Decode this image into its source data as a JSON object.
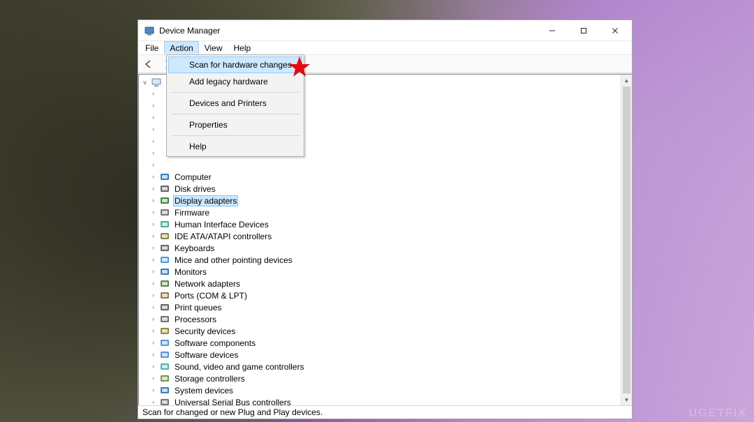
{
  "watermark": "UGETFIX",
  "window": {
    "title": "Device Manager"
  },
  "menubar": {
    "file": "File",
    "action": "Action",
    "view": "View",
    "help": "Help"
  },
  "dropdown": {
    "scan": "Scan for hardware changes",
    "add_legacy": "Add legacy hardware",
    "devices_printers": "Devices and Printers",
    "properties": "Properties",
    "help": "Help"
  },
  "tree": {
    "items": [
      {
        "label": "Computer",
        "color": "#2a6fb0"
      },
      {
        "label": "Disk drives",
        "color": "#555"
      },
      {
        "label": "Display adapters",
        "color": "#2a7a2a",
        "selected": true
      },
      {
        "label": "Firmware",
        "color": "#666"
      },
      {
        "label": "Human Interface Devices",
        "color": "#3a8"
      },
      {
        "label": "IDE ATA/ATAPI controllers",
        "color": "#7a7a3a"
      },
      {
        "label": "Keyboards",
        "color": "#555"
      },
      {
        "label": "Mice and other pointing devices",
        "color": "#3a90e0"
      },
      {
        "label": "Monitors",
        "color": "#2a6fb0"
      },
      {
        "label": "Network adapters",
        "color": "#4a7a3a"
      },
      {
        "label": "Ports (COM & LPT)",
        "color": "#8a6a3a"
      },
      {
        "label": "Print queues",
        "color": "#555"
      },
      {
        "label": "Processors",
        "color": "#666"
      },
      {
        "label": "Security devices",
        "color": "#8a7a2a"
      },
      {
        "label": "Software components",
        "color": "#4a8ad0"
      },
      {
        "label": "Software devices",
        "color": "#4a8ad0"
      },
      {
        "label": "Sound, video and game controllers",
        "color": "#4aa"
      },
      {
        "label": "Storage controllers",
        "color": "#6a8a3a"
      },
      {
        "label": "System devices",
        "color": "#2a6fb0"
      },
      {
        "label": "Universal Serial Bus controllers",
        "color": "#666"
      }
    ]
  },
  "statusbar": {
    "text": "Scan for changed or new Plug and Play devices."
  }
}
